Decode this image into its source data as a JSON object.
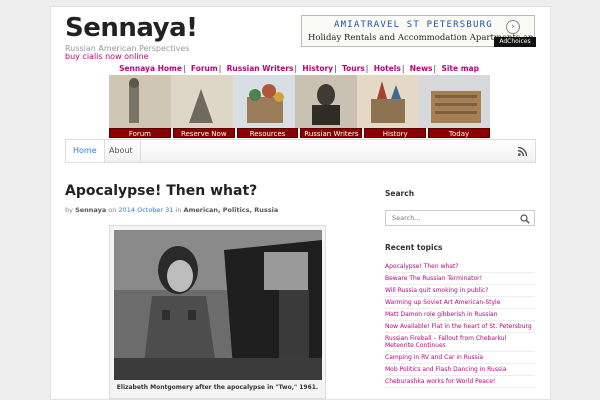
{
  "site": {
    "title": "Sennaya!",
    "description": "Russian American Perspectives",
    "link": "buy cialis now online"
  },
  "ad": {
    "title": "AMIATRAVEL ST PETERSBURG",
    "text": "Holiday Rentals and Accommodation Apartments and Day",
    "choices": "AdChoices",
    "arrow": "›"
  },
  "topnav": [
    "Sennaya Home",
    "Forum",
    "Russian Writers",
    "History",
    "Tours",
    "Hotels",
    "News",
    "Site map"
  ],
  "banner_buttons": [
    "Forum",
    "Reserve Now",
    "Resources",
    "Russian Writers",
    "History",
    "Today"
  ],
  "menu": {
    "tabs": [
      "Home",
      "About"
    ]
  },
  "post": {
    "title": "Apocalypse! Then what?",
    "by": "by",
    "author": "Sennaya",
    "on": "on",
    "date": "2014 October 31",
    "in": "in",
    "categories": "American, Politics, Russia",
    "caption": "Elizabeth Montgomery after the apocalypse in \"Two,\" 1961."
  },
  "sidebar": {
    "search_heading": "Search",
    "search_placeholder": "Search...",
    "recent_heading": "Recent topics",
    "recent": [
      "Apocalypse! Then what?",
      "Beware The Russian Terminator!",
      "Will Russia quit smoking in public?",
      "Warming up Soviet Art American-Style",
      "Matt Damon role gibberish in Russian",
      "Now Available! Flat in the heart of St. Petersburg",
      "Russian Fireball – Fallout from Chebarkul Meteorite Continues",
      "Camping in RV and Car in Russia",
      "Mob Politics and Flash Dancing in Russia",
      "Cheburashka works for World Peace!"
    ]
  },
  "colors": {
    "link": "#c0007a",
    "banner_button": "#8b0000",
    "active_tab": "#2a7fd4"
  }
}
